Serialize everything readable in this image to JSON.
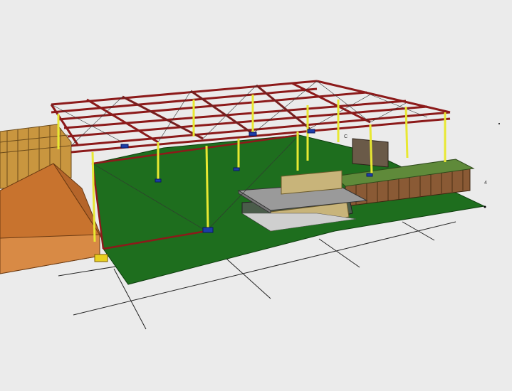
{
  "scene": {
    "view_labels": [
      "C",
      "4"
    ],
    "colors": {
      "background": "#ebebeb",
      "ground": "#1e6e1e",
      "truss": "#8c1a1a",
      "columns": "#e8e832",
      "bases": "#1c3ca8",
      "building_roof": "#9a9a9a",
      "building_wall": "#c8b47a",
      "wood": "#c8732e",
      "grid_lines": "#222222"
    }
  }
}
